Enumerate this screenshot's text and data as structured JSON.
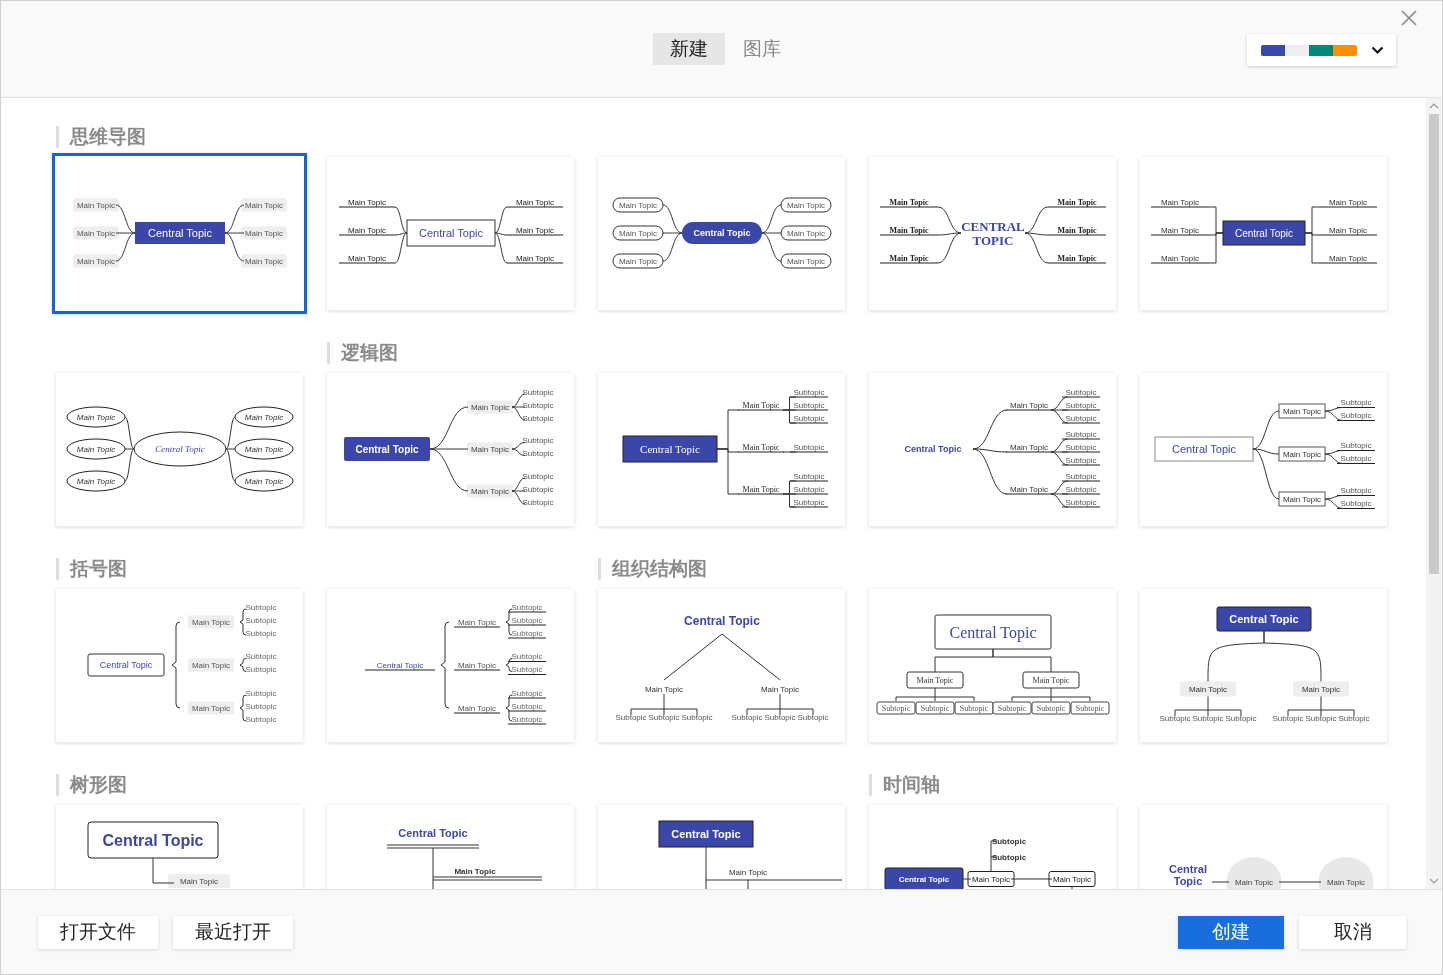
{
  "tabs": [
    {
      "label": "新建",
      "selected": true
    },
    {
      "label": "图库",
      "selected": false
    }
  ],
  "theme_swatches": [
    {
      "color": "#3949ab"
    },
    {
      "color": "#eeeeee"
    },
    {
      "color": "#00897b"
    },
    {
      "color": "#ff8f00"
    }
  ],
  "templates": [
    {
      "heading": "思维导图",
      "kind": "mind-tag",
      "selected": true,
      "central": "Central Topic",
      "mains": [
        "Main Topic",
        "Main Topic",
        "Main Topic",
        "Main Topic",
        "Main Topic",
        "Main Topic"
      ]
    },
    {
      "kind": "mind-line",
      "selected": false,
      "central": "Central Topic",
      "mains": [
        "Main Topic",
        "Main Topic",
        "Main Topic",
        "Main Topic",
        "Main Topic",
        "Main Topic"
      ]
    },
    {
      "kind": "mind-capsule",
      "selected": false,
      "central": "Central Topic",
      "mains": [
        "Main Topic",
        "Main Topic",
        "Main Topic",
        "Main Topic",
        "Main Topic",
        "Main Topic"
      ]
    },
    {
      "kind": "mind-serif",
      "selected": false,
      "central": "CENTRAL TOPIC",
      "mains": [
        "Main Topic",
        "Main Topic",
        "Main Topic",
        "Main Topic",
        "Main Topic",
        "Main Topic"
      ]
    },
    {
      "kind": "mind-block",
      "selected": false,
      "central": "Central Topic",
      "mains": [
        "Main Topic",
        "Main Topic",
        "Main Topic",
        "Main Topic",
        "Main Topic",
        "Main Topic"
      ]
    },
    {
      "kind": "mind-oval",
      "selected": false,
      "central": "Central Topic",
      "mains": [
        "Main Topic",
        "Main Topic",
        "Main Topic",
        "Main Topic",
        "Main Topic",
        "Main Topic"
      ]
    },
    {
      "heading": "逻辑图",
      "kind": "logic-filled",
      "selected": false,
      "central": "Central Topic",
      "mains": [
        "Main Topic",
        "Main Topic",
        "Main Topic"
      ],
      "subs": [
        [
          "Subtopic",
          "Subtopic",
          "Subtopic"
        ],
        [
          "Subtopic",
          "Subtopic"
        ],
        [
          "Subtopic",
          "Subtopic",
          "Subtopic"
        ]
      ]
    },
    {
      "kind": "logic-serif",
      "selected": false,
      "central": "Central Topic",
      "mains": [
        "Main Topic",
        "Main Topic",
        "Main Topic"
      ],
      "subs": [
        [
          "Subtopic",
          "Subtopic",
          "Subtopic"
        ],
        [
          "Subtopic"
        ],
        [
          "Subtopic",
          "Subtopic",
          "Subtopic"
        ]
      ]
    },
    {
      "kind": "logic-plain",
      "selected": false,
      "central": "Central Topic",
      "mains": [
        "Main Topic",
        "Main Topic",
        "Main Topic"
      ],
      "subs": [
        [
          "Subtopic",
          "Subtopic",
          "Subtopic"
        ],
        [
          "Subtopic",
          "Subtopic",
          "Subtopic"
        ],
        [
          "Subtopic",
          "Subtopic",
          "Subtopic"
        ]
      ]
    },
    {
      "kind": "logic-outlined",
      "selected": false,
      "central": "Central Topic",
      "mains": [
        "Main Topic",
        "Main Topic",
        "Main Topic"
      ],
      "subs": [
        [
          "Subtopic",
          "Subtopic"
        ],
        [
          "Subtopic",
          "Subtopic"
        ],
        [
          "Subtopic",
          "Subtopic"
        ]
      ]
    },
    {
      "heading": "括号图",
      "kind": "bracket-outlined",
      "selected": false,
      "central": "Central Topic",
      "mains": [
        "Main Topic",
        "Main Topic",
        "Main Topic"
      ],
      "subs": [
        [
          "Subtopic",
          "Subtopic",
          "Subtopic"
        ],
        [
          "Subtopic",
          "Subtopic"
        ],
        [
          "Subtopic",
          "Subtopic",
          "Subtopic"
        ]
      ]
    },
    {
      "kind": "bracket-underlined",
      "selected": false,
      "central": "Central Topic",
      "mains": [
        "Main Topic",
        "Main Topic",
        "Main Topic"
      ],
      "subs": [
        [
          "Subtopic",
          "Subtopic",
          "Subtopic"
        ],
        [
          "Subtopic",
          "Subtopic"
        ],
        [
          "Subtopic",
          "Subtopic",
          "Subtopic"
        ]
      ]
    },
    {
      "heading": "组织结构图",
      "kind": "org-plain",
      "selected": false,
      "central": "Central Topic",
      "mains": [
        "Main Topic",
        "Main Topic"
      ],
      "subs": [
        [
          "Subtopic",
          "Subtopic",
          "Subtopic"
        ],
        [
          "Subtopic",
          "Subtopic",
          "Subtopic"
        ]
      ]
    },
    {
      "kind": "org-boxed",
      "selected": false,
      "central": "Central Topic",
      "mains": [
        "Main Topic",
        "Main Topic"
      ],
      "subs": [
        [
          "Subtopic",
          "Subtopic",
          "Subtopic"
        ],
        [
          "Subtopic",
          "Subtopic",
          "Subtopic"
        ]
      ]
    },
    {
      "kind": "org-filled",
      "selected": false,
      "central": "Central Topic",
      "mains": [
        "Main Topic",
        "Main Topic"
      ],
      "subs": [
        [
          "Subtopic",
          "Subtopic",
          "Subtopic"
        ],
        [
          "Subtopic",
          "Subtopic",
          "Subtopic"
        ]
      ]
    },
    {
      "heading": "树形图",
      "kind": "tree-boxed",
      "selected": false,
      "central": "Central Topic",
      "mains": [
        "Main Topic"
      ]
    },
    {
      "kind": "tree-underlined",
      "selected": false,
      "central": "Central Topic",
      "mains": [
        "Main Topic"
      ]
    },
    {
      "kind": "tree-filled",
      "selected": false,
      "central": "Central Topic",
      "mains": [
        "Main Topic"
      ]
    },
    {
      "heading": "时间轴",
      "kind": "timeline-boxed",
      "selected": false,
      "central": "Central Topic",
      "mains": [
        "Main Topic",
        "Main Topic"
      ],
      "subs": [
        [
          "Subtopic",
          "Subtopic"
        ]
      ]
    },
    {
      "kind": "timeline-circle",
      "selected": false,
      "central": "Central Topic",
      "mains": [
        "Main Topic",
        "Main Topic"
      ]
    }
  ],
  "footer": {
    "left_buttons": [
      "打开文件",
      "最近打开"
    ],
    "create": "创建",
    "cancel": "取消"
  }
}
